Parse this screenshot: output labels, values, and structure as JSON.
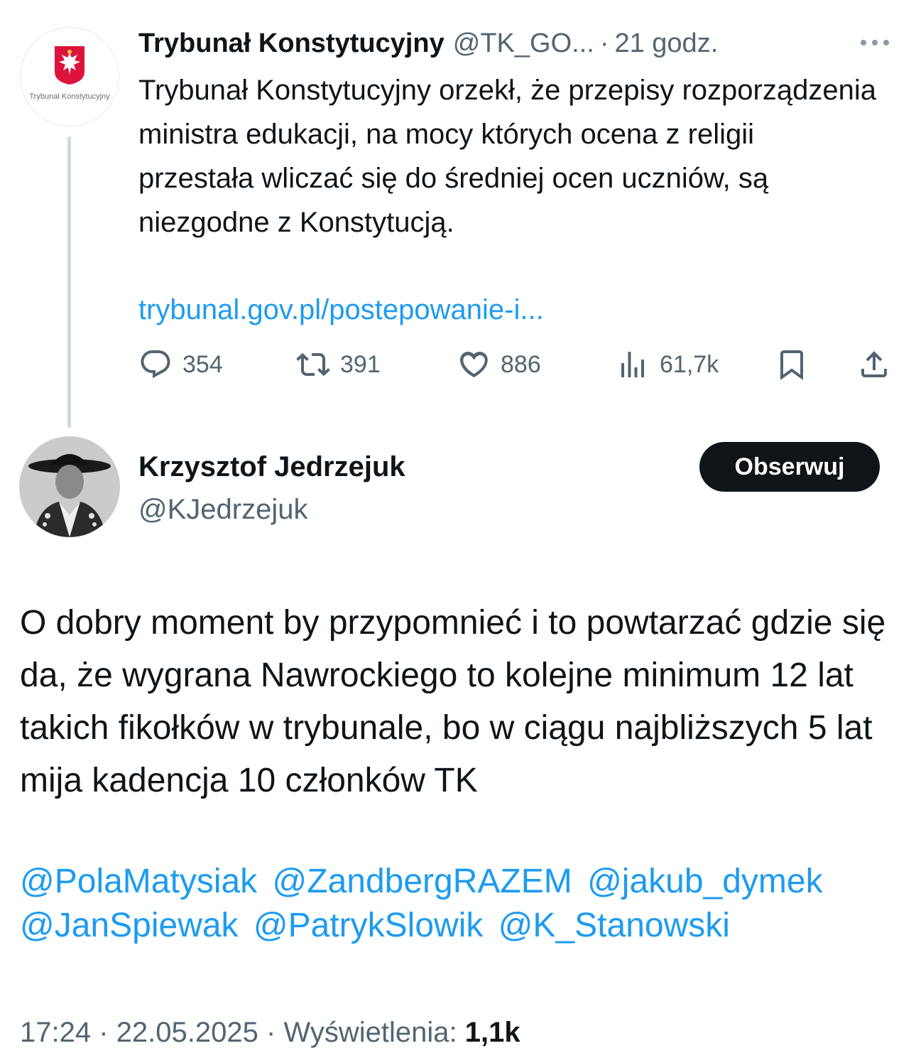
{
  "parent_tweet": {
    "avatar_label": "Trybunał Konstytucyjny",
    "author_name": "Trybunał Konstytucyjny",
    "handle": "@TK_GO...",
    "separator": "·",
    "time": "21 godz.",
    "text": "Trybunał Konstytucyjny orzekł, że przepisy rozporządzenia ministra edukacji, na mocy których ocena z religii przestała wliczać się do średniej ocen uczniów, są niezgodne z Konstytucją.",
    "link": "trybunal.gov.pl/postepowanie-i...",
    "stats": {
      "replies": "354",
      "reposts": "391",
      "likes": "886",
      "views": "61,7k"
    }
  },
  "tweet": {
    "author_name": "Krzysztof Jedrzejuk",
    "handle": "@KJedrzejuk",
    "follow_label": "Obserwuj",
    "text": "O dobry moment by przypomnieć i to powtarzać gdzie się da, że wygrana Nawrockiego to kolejne minimum 12 lat takich fikołków w trybunale, bo w ciągu najbliższych 5 lat mija kadencja 10 członków TK",
    "mentions": [
      "@PolaMatysiak",
      "@ZandbergRAZEM",
      "@jakub_dymek",
      "@JanSpiewak",
      "@PatrykSlowik",
      "@K_Stanowski"
    ],
    "time": "17:24",
    "date": "22.05.2025",
    "separator": "·",
    "views_label": "Wyświetlenia:",
    "views_count": "1,1k"
  },
  "colors": {
    "link": "#1d9bf0",
    "secondary_text": "#536471",
    "primary_text": "#0f1419",
    "button_bg": "#0f1419",
    "thread_line": "#cfd9de"
  },
  "icons": [
    "more-icon",
    "reply-icon",
    "repost-icon",
    "like-icon",
    "views-icon",
    "bookmark-icon",
    "share-icon",
    "emblem-icon"
  ]
}
